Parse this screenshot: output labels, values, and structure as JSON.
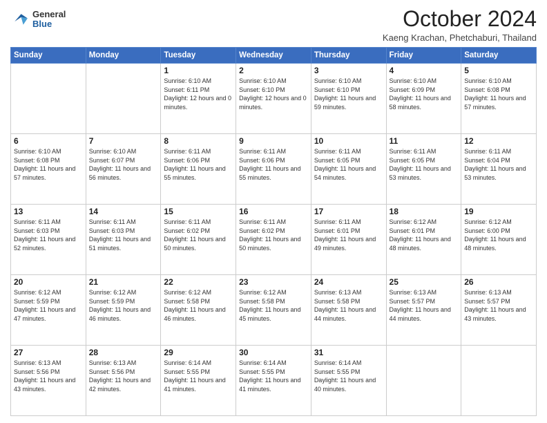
{
  "logo": {
    "general": "General",
    "blue": "Blue"
  },
  "header": {
    "month": "October 2024",
    "location": "Kaeng Krachan, Phetchaburi, Thailand"
  },
  "weekdays": [
    "Sunday",
    "Monday",
    "Tuesday",
    "Wednesday",
    "Thursday",
    "Friday",
    "Saturday"
  ],
  "weeks": [
    [
      {
        "day": null,
        "info": null
      },
      {
        "day": null,
        "info": null
      },
      {
        "day": "1",
        "sunrise": "Sunrise: 6:10 AM",
        "sunset": "Sunset: 6:11 PM",
        "daylight": "Daylight: 12 hours and 0 minutes."
      },
      {
        "day": "2",
        "sunrise": "Sunrise: 6:10 AM",
        "sunset": "Sunset: 6:10 PM",
        "daylight": "Daylight: 12 hours and 0 minutes."
      },
      {
        "day": "3",
        "sunrise": "Sunrise: 6:10 AM",
        "sunset": "Sunset: 6:10 PM",
        "daylight": "Daylight: 11 hours and 59 minutes."
      },
      {
        "day": "4",
        "sunrise": "Sunrise: 6:10 AM",
        "sunset": "Sunset: 6:09 PM",
        "daylight": "Daylight: 11 hours and 58 minutes."
      },
      {
        "day": "5",
        "sunrise": "Sunrise: 6:10 AM",
        "sunset": "Sunset: 6:08 PM",
        "daylight": "Daylight: 11 hours and 57 minutes."
      }
    ],
    [
      {
        "day": "6",
        "sunrise": "Sunrise: 6:10 AM",
        "sunset": "Sunset: 6:08 PM",
        "daylight": "Daylight: 11 hours and 57 minutes."
      },
      {
        "day": "7",
        "sunrise": "Sunrise: 6:10 AM",
        "sunset": "Sunset: 6:07 PM",
        "daylight": "Daylight: 11 hours and 56 minutes."
      },
      {
        "day": "8",
        "sunrise": "Sunrise: 6:11 AM",
        "sunset": "Sunset: 6:06 PM",
        "daylight": "Daylight: 11 hours and 55 minutes."
      },
      {
        "day": "9",
        "sunrise": "Sunrise: 6:11 AM",
        "sunset": "Sunset: 6:06 PM",
        "daylight": "Daylight: 11 hours and 55 minutes."
      },
      {
        "day": "10",
        "sunrise": "Sunrise: 6:11 AM",
        "sunset": "Sunset: 6:05 PM",
        "daylight": "Daylight: 11 hours and 54 minutes."
      },
      {
        "day": "11",
        "sunrise": "Sunrise: 6:11 AM",
        "sunset": "Sunset: 6:05 PM",
        "daylight": "Daylight: 11 hours and 53 minutes."
      },
      {
        "day": "12",
        "sunrise": "Sunrise: 6:11 AM",
        "sunset": "Sunset: 6:04 PM",
        "daylight": "Daylight: 11 hours and 53 minutes."
      }
    ],
    [
      {
        "day": "13",
        "sunrise": "Sunrise: 6:11 AM",
        "sunset": "Sunset: 6:03 PM",
        "daylight": "Daylight: 11 hours and 52 minutes."
      },
      {
        "day": "14",
        "sunrise": "Sunrise: 6:11 AM",
        "sunset": "Sunset: 6:03 PM",
        "daylight": "Daylight: 11 hours and 51 minutes."
      },
      {
        "day": "15",
        "sunrise": "Sunrise: 6:11 AM",
        "sunset": "Sunset: 6:02 PM",
        "daylight": "Daylight: 11 hours and 50 minutes."
      },
      {
        "day": "16",
        "sunrise": "Sunrise: 6:11 AM",
        "sunset": "Sunset: 6:02 PM",
        "daylight": "Daylight: 11 hours and 50 minutes."
      },
      {
        "day": "17",
        "sunrise": "Sunrise: 6:11 AM",
        "sunset": "Sunset: 6:01 PM",
        "daylight": "Daylight: 11 hours and 49 minutes."
      },
      {
        "day": "18",
        "sunrise": "Sunrise: 6:12 AM",
        "sunset": "Sunset: 6:01 PM",
        "daylight": "Daylight: 11 hours and 48 minutes."
      },
      {
        "day": "19",
        "sunrise": "Sunrise: 6:12 AM",
        "sunset": "Sunset: 6:00 PM",
        "daylight": "Daylight: 11 hours and 48 minutes."
      }
    ],
    [
      {
        "day": "20",
        "sunrise": "Sunrise: 6:12 AM",
        "sunset": "Sunset: 5:59 PM",
        "daylight": "Daylight: 11 hours and 47 minutes."
      },
      {
        "day": "21",
        "sunrise": "Sunrise: 6:12 AM",
        "sunset": "Sunset: 5:59 PM",
        "daylight": "Daylight: 11 hours and 46 minutes."
      },
      {
        "day": "22",
        "sunrise": "Sunrise: 6:12 AM",
        "sunset": "Sunset: 5:58 PM",
        "daylight": "Daylight: 11 hours and 46 minutes."
      },
      {
        "day": "23",
        "sunrise": "Sunrise: 6:12 AM",
        "sunset": "Sunset: 5:58 PM",
        "daylight": "Daylight: 11 hours and 45 minutes."
      },
      {
        "day": "24",
        "sunrise": "Sunrise: 6:13 AM",
        "sunset": "Sunset: 5:58 PM",
        "daylight": "Daylight: 11 hours and 44 minutes."
      },
      {
        "day": "25",
        "sunrise": "Sunrise: 6:13 AM",
        "sunset": "Sunset: 5:57 PM",
        "daylight": "Daylight: 11 hours and 44 minutes."
      },
      {
        "day": "26",
        "sunrise": "Sunrise: 6:13 AM",
        "sunset": "Sunset: 5:57 PM",
        "daylight": "Daylight: 11 hours and 43 minutes."
      }
    ],
    [
      {
        "day": "27",
        "sunrise": "Sunrise: 6:13 AM",
        "sunset": "Sunset: 5:56 PM",
        "daylight": "Daylight: 11 hours and 43 minutes."
      },
      {
        "day": "28",
        "sunrise": "Sunrise: 6:13 AM",
        "sunset": "Sunset: 5:56 PM",
        "daylight": "Daylight: 11 hours and 42 minutes."
      },
      {
        "day": "29",
        "sunrise": "Sunrise: 6:14 AM",
        "sunset": "Sunset: 5:55 PM",
        "daylight": "Daylight: 11 hours and 41 minutes."
      },
      {
        "day": "30",
        "sunrise": "Sunrise: 6:14 AM",
        "sunset": "Sunset: 5:55 PM",
        "daylight": "Daylight: 11 hours and 41 minutes."
      },
      {
        "day": "31",
        "sunrise": "Sunrise: 6:14 AM",
        "sunset": "Sunset: 5:55 PM",
        "daylight": "Daylight: 11 hours and 40 minutes."
      },
      {
        "day": null,
        "info": null
      },
      {
        "day": null,
        "info": null
      }
    ]
  ]
}
